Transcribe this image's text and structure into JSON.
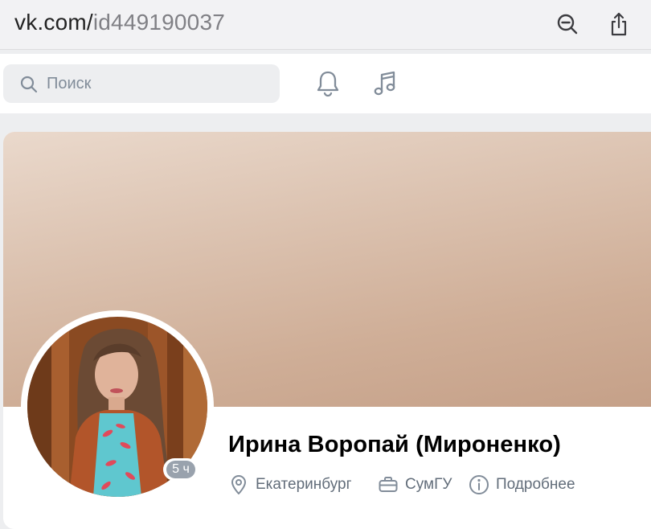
{
  "browser": {
    "url_host": "vk.com/",
    "url_path": "id449190037",
    "icons": [
      "zoom-out-icon",
      "share-icon"
    ]
  },
  "header": {
    "search_placeholder": "Поиск",
    "icons": [
      "search-icon",
      "bell-icon",
      "music-icon"
    ]
  },
  "profile": {
    "name": "Ирина Воропай (Мироненко)",
    "online_badge": "5 ч",
    "city": "Екатеринбург",
    "university": "СумГУ",
    "more_label": "Подробнее",
    "icons": [
      "location-pin-icon",
      "briefcase-icon",
      "info-icon"
    ]
  },
  "colors": {
    "page_bg": "#edeef0",
    "secondary_text": "#626d7a",
    "placeholder": "#818c99",
    "badge": "#99a2ad"
  }
}
